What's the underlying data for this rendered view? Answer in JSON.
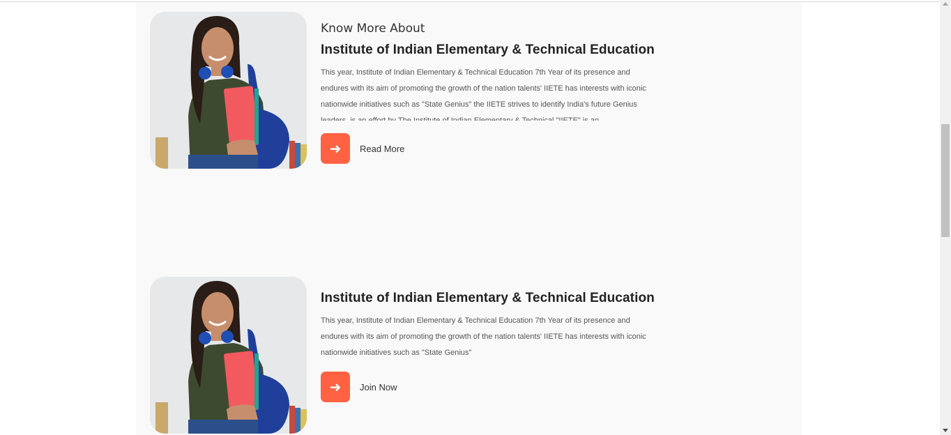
{
  "colors": {
    "accent": "#ff6243",
    "panel_background": "#f9f9f9",
    "page_background": "#ffffff"
  },
  "cards": [
    {
      "eyebrow": "Know More About",
      "title": "Institute of Indian Elementary & Technical Education",
      "description": "This year, Institute of Indian Elementary & Technical Education 7th Year of its presence and endures with its aim of promoting the growth of the nation talents' IIETE has interests with iconic nationwide initiatives such as \"State Genius\" the IIETE strives to identify India's future Genius leaders, is an effort by The Institute of Indian Elementary & Technical \"IIETE\" is an",
      "cta_icon": "arrow-right-icon",
      "cta_label": "Read More"
    },
    {
      "title": "Institute of Indian Elementary & Technical Education",
      "description": "This year, Institute of Indian Elementary & Technical Education 7th Year of its presence and endures with its aim of promoting the growth of the nation talents' IIETE has interests with iconic nationwide initiatives such as \"State Genius\"",
      "cta_icon": "arrow-right-icon",
      "cta_label": "Join Now"
    }
  ]
}
